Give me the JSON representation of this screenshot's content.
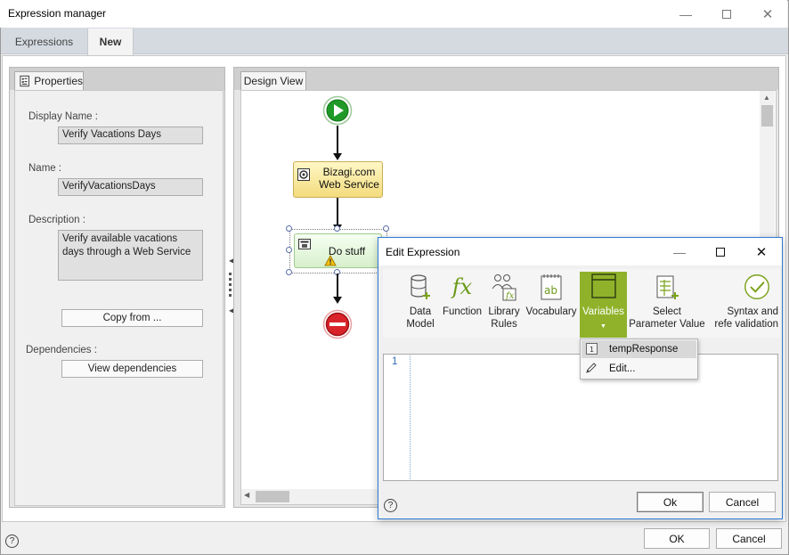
{
  "window": {
    "title": "Expression manager"
  },
  "tabs": [
    {
      "label": "Expressions",
      "active": false
    },
    {
      "label": "New",
      "active": true
    }
  ],
  "properties": {
    "tab_label": "Properties",
    "display_name_label": "Display Name :",
    "display_name_value": "Verify Vacations Days",
    "name_label": "Name :",
    "name_value": "VerifyVacationsDays",
    "description_label": "Description :",
    "description_value": "Verify available vacations days through a Web Service",
    "copy_from_label": "Copy from ...",
    "dependencies_label": "Dependencies :",
    "view_dependencies_label": "View dependencies"
  },
  "design_view": {
    "tab_label": "Design View",
    "nodes": {
      "web_service_label": "Bizagi.com Web Service",
      "do_stuff_label": "Do stuff"
    }
  },
  "footer": {
    "ok_label": "OK",
    "cancel_label": "Cancel"
  },
  "edit_expression": {
    "title": "Edit Expression",
    "toolbar": {
      "data_model": "Data Model",
      "function": "Function",
      "library_rules": "Library Rules",
      "vocabulary": "Vocabulary",
      "variables": "Variables",
      "select_parameter_value": "Select Parameter Value",
      "syntax_validation": "Syntax and refe validation"
    },
    "dropdown": {
      "item1": "tempResponse",
      "item2": "Edit..."
    },
    "editor": {
      "line_number": "1"
    },
    "ok_label": "Ok",
    "cancel_label": "Cancel"
  },
  "colors": {
    "variables_active": "#8fb22a",
    "dialog_border": "#2e7bd6",
    "start_event": "#1f9a28",
    "end_event": "#d9232b"
  }
}
